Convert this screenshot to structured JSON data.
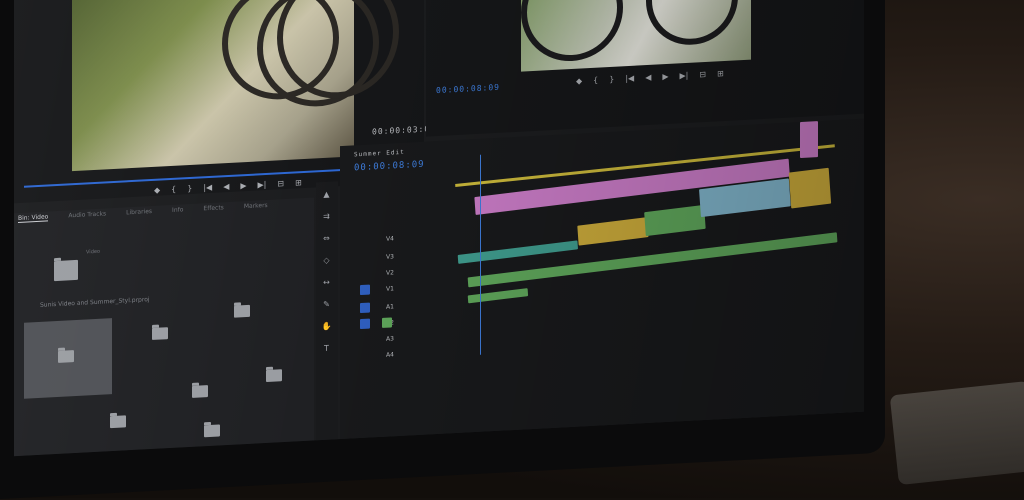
{
  "app": {
    "accent": "#2c66d1"
  },
  "source_monitor": {
    "timecode_left": "",
    "timecode_right": "00:00:03:02",
    "controls": [
      "◆",
      "{",
      "}",
      "|◀",
      "◀",
      "▶",
      "▶|",
      "⊟",
      "⊞",
      "📷"
    ]
  },
  "program_monitor": {
    "timecode": "00:00:08:09",
    "controls": [
      "◆",
      "{",
      "}",
      "|◀",
      "◀",
      "▶",
      "▶|",
      "⊟",
      "⊞"
    ]
  },
  "project_panel": {
    "tabs": [
      "Bin: Video",
      "Audio Tracks",
      "Libraries",
      "Info",
      "Effects",
      "Markers"
    ],
    "path": "Sunis Video and Summer_Styl.prproj",
    "bins": [
      "Video",
      "",
      "",
      "",
      "",
      "",
      ""
    ]
  },
  "timeline": {
    "sequence_tab": "Summer Edit",
    "timecode": "00:00:08:09",
    "tracks": [
      "V4",
      "V3",
      "V2",
      "V1",
      "A1",
      "A2",
      "A3",
      "A4"
    ],
    "colors": {
      "magenta": "#c77ac4",
      "teal": "#3f9b8d",
      "yellow": "#c9a93a",
      "green": "#5ea55a",
      "lightblue": "#7fb3c9",
      "playhead": "#3d7bd9"
    }
  }
}
